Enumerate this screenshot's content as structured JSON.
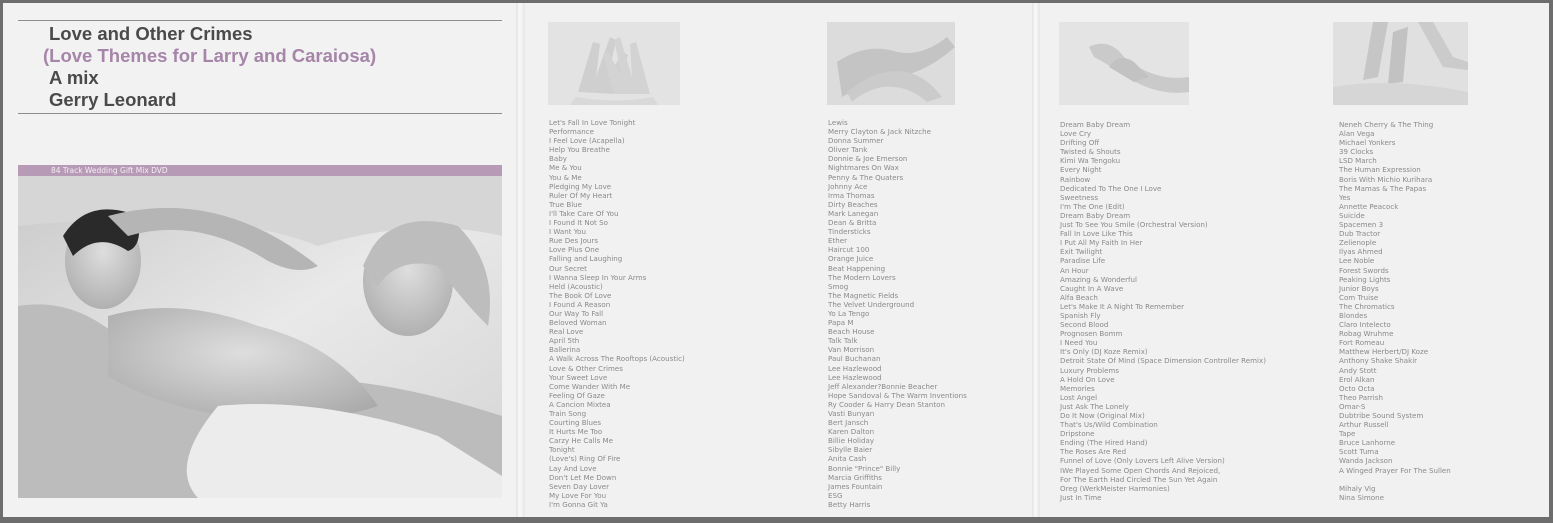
{
  "cover": {
    "line1": "Love and Other Crimes",
    "line2": "(Love Themes for Larry and Caraiosa)",
    "line3": "A mix",
    "line4": "Gerry Leonard",
    "banner": "84 Track Wedding Gift Mix DVD",
    "photo": "black-and-white photo of a couple lying in bed"
  },
  "panels": [
    {
      "thumb": "photo of two crossed hands",
      "tracks": [
        "Let's Fall In Love Tonight",
        "Performance",
        "I Feel Love (Acapella)",
        "Help You Breathe",
        "Baby",
        "Me & You",
        "You & Me",
        "Pledging My Love",
        "Ruler Of My Heart",
        "True Blue",
        "I'll Take Care Of You",
        "I Found It Not So",
        "I Want You",
        "Rue Des Jours",
        "Love Plus One",
        "Falling and Laughing",
        "Our Secret",
        "I Wanna Sleep In Your Arms",
        "Held (Acoustic)",
        "The Book Of Love",
        "I Found A Reason",
        "Our Way To Fall",
        "Beloved Woman",
        "Real Love",
        "April 5th",
        "Ballerina",
        "A Walk Across The Rooftops (Acoustic)",
        "Love & Other Crimes",
        "Your Sweet Love",
        "Come Wander With Me",
        "Feeling Of Gaze",
        "A Cancion Mixtea",
        "Train Song",
        "Courting Blues",
        "It Hurts Me Too",
        "Carzy He Calls Me",
        "Tonight",
        "(Love's) Ring Of Fire",
        "Lay And Love",
        "Don't Let Me Down",
        "Seven Day Lover",
        "My Love For You",
        "I'm Gonna Git Ya"
      ]
    },
    {
      "thumb": "photo of clasped hands",
      "tracks": [
        "Lewis",
        "Merry Clayton & Jack Nitzche",
        "Donna Summer",
        "Oliver Tank",
        "Donnie & Joe Emerson",
        "Nightmares On Wax",
        "Penny & The Quaters",
        "Johnny Ace",
        "Irma Thomas",
        "Dirty Beaches",
        "Mark Lanegan",
        "Dean & Britta",
        "Tindersticks",
        "Ether",
        "Haircut 100",
        "Orange Juice",
        "Beat Happening",
        "The Modern Lovers",
        "Smog",
        "The Magnetic Fields",
        "The Velvet Underground",
        "Yo La Tengo",
        "Papa M",
        "Beach House",
        "Talk Talk",
        "Van Morrison",
        "Paul Buchanan",
        "Lee Hazlewood",
        "Lee Hazlewood",
        "Jeff Alexander?Bonnie Beacher",
        "Hope Sandoval & The Warm Inventions",
        "Ry Cooder & Harry Dean Stanton",
        "Vasti Bunyan",
        "Bert Jansch",
        "Karen Dalton",
        "Billie Holiday",
        "Sibylle Baier",
        "Anita Cash",
        "Bonnie \"Prince\" Billy",
        "Marcia Griffiths",
        "James Fountain",
        "ESG",
        "Betty Harris"
      ]
    },
    {
      "thumb": "photo of a hand holding a wrist",
      "tracks": [
        "Dream Baby Dream",
        "Love Cry",
        "Drifting Off",
        "Twisted & Shouts",
        "Kimi Wa Tengoku",
        "Every Night",
        "Rainbow",
        "Dedicated To The One I Love",
        "Sweetness",
        "I'm The One (Edit)",
        "Dream Baby Dream",
        "Just To See You Smile (Orchestral Version)",
        "Fall In Love Like This",
        "I Put All My Faith In Her",
        "Exit Twilight",
        "Paradise Life",
        "An Hour",
        "Amazing & Wonderful",
        "Caught In A Wave",
        "Alfa Beach",
        "Let's Make It A Night To Remember",
        "Spanish Fly",
        "Second Blood",
        "Prognosen Bomm",
        "I Need You",
        "It's Only (DJ Koze Remix)",
        "Detroit State Of Mind (Space Dimension Controller Remix)",
        "Luxury Problems",
        "A Hold On Love",
        "Memories",
        "Lost Angel",
        "Just Ask The Lonely",
        "Do It Now (Original Mix)",
        "That's Us/Wild Combination",
        "Dripstone",
        "Ending (The Hired Hand)",
        "The Roses Are Red",
        "Funnel of Love (Only Lovers Left Alive Version)",
        "IWe Played Some Open Chords And Rejoiced,",
        "For The Earth Had Circled The Sun Yet Again",
        "Oreg (WerkMeister Harmonies)",
        "Just In Time"
      ]
    },
    {
      "thumb": "photo of entwined legs on a bed",
      "tracks": [
        "Neneh Cherry & The Thing",
        "Alan Vega",
        "Michael Yonkers",
        "39 Clocks",
        "LSD March",
        "The Human Expression",
        "Boris With Michio Kurihara",
        "The Mamas & The Papas",
        "Yes",
        "Annette Peacock",
        "Suicide",
        "Spacemen 3",
        "Dub Tractor",
        "Zelienople",
        "Ilyas Ahmed",
        "Lee Noble",
        "Forest Swords",
        "Peaking Lights",
        "Junior Boys",
        "Com Truise",
        "The Chromatics",
        "Blondes",
        "Claro Intelecto",
        "Robag Wruhme",
        "Fort Romeau",
        "Matthew Herbert/DJ Koze",
        "Anthony Shake Shakir",
        "Andy Stott",
        "Erol Alkan",
        "Octo Octa",
        "Theo Parrish",
        "Omar-S",
        "Dubtribe Sound System",
        "Arthur Russell",
        "Tape",
        "Bruce Lanhorne",
        "Scott Tuma",
        "Wanda Jackson",
        "A Winged Prayer For The Sullen",
        "",
        "Mihaly Vig",
        "Nina Simone"
      ]
    }
  ]
}
